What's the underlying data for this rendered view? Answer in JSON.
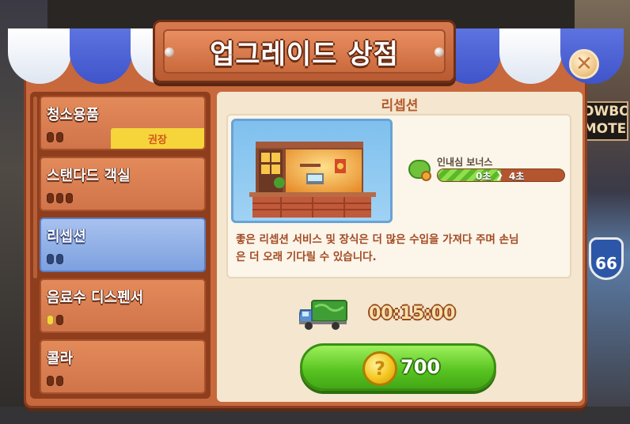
{
  "title": "업그레이드 상점",
  "close_icon": "✕",
  "colors": {
    "panel": "#c7693d",
    "selected": "#7da0df",
    "accent_green": "#56c21f",
    "badge": "#f5d53a"
  },
  "items": [
    {
      "label": "청소용품",
      "badge": "권장",
      "level": 0,
      "max": 2
    },
    {
      "label": "스탠다드 객실",
      "level": 0,
      "max": 3
    },
    {
      "label": "리셉션",
      "level": 0,
      "max": 2,
      "selected": true
    },
    {
      "label": "음료수 디스펜서",
      "level": 1,
      "max": 2
    },
    {
      "label": "콜라",
      "level": 0,
      "max": 2
    }
  ],
  "detail": {
    "title": "리셉션",
    "bonus": {
      "label": "인내심 보너스",
      "from": "0초",
      "to": "4초",
      "progress": 0.5
    },
    "description_line1": "좋은 리셉션 서비스 및 장식은 더 많은 수입을 가져다 주며 손님",
    "description_line2": "은 더 오래 기다릴 수 있습니다.",
    "timer": "00:15:00",
    "price": "700",
    "coin_icon": "coin-icon",
    "truck_icon": "delivery-truck-icon"
  },
  "background": {
    "sign_text": "OWBO MOTE",
    "route_text": "66"
  }
}
